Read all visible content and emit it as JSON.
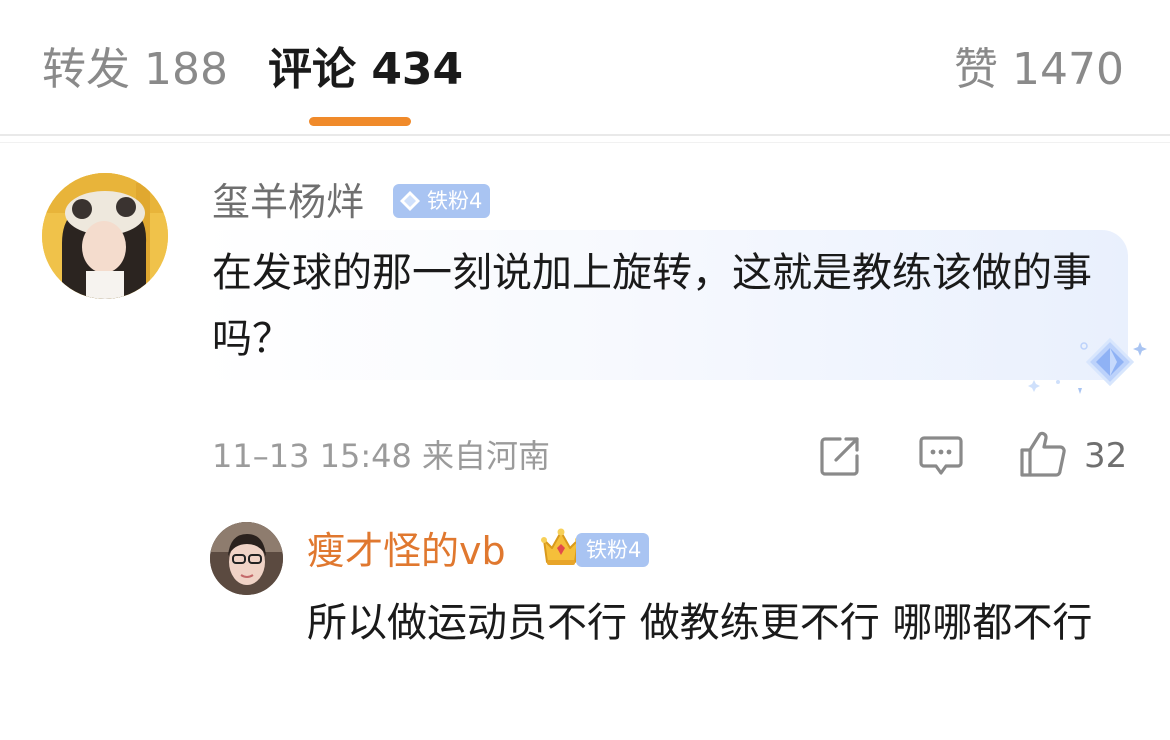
{
  "tabs": {
    "repost": "转发 188",
    "comment": "评论 434",
    "like": "赞 1470"
  },
  "comment": {
    "username": "玺羊杨烊",
    "badge": "铁粉4",
    "text": "在发球的那一刻说加上旋转，这就是教练该做的事吗？",
    "meta": "11–13 15:48 来自河南",
    "like_count": "32"
  },
  "reply": {
    "username": "瘦才怪的vb",
    "badge": "铁粉4",
    "text": "所以做运动员不行 做教练更不行 哪哪都不行"
  },
  "colors": {
    "accent_orange": "#f08a2a",
    "reply_username": "#e0782f",
    "badge_blue": "#a9c4f2"
  }
}
